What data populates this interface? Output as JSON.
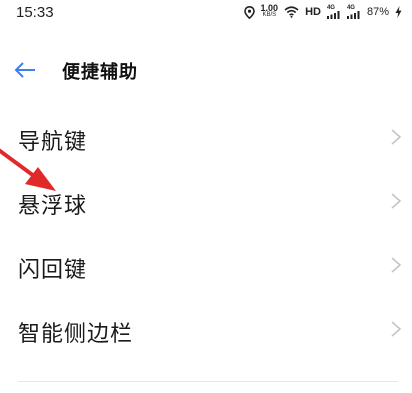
{
  "status_bar": {
    "time": "15:33",
    "net_speed_value": "1.00",
    "net_speed_unit": "KB/S",
    "hd_label": "HD",
    "sim1_label": "4G",
    "sim2_label": "4G",
    "battery": "87%",
    "icons": [
      "location-icon",
      "wifi-icon",
      "signal-icon",
      "charging-icon"
    ]
  },
  "header": {
    "back_icon": "arrow-left-icon",
    "title": "便捷辅助"
  },
  "list": {
    "items": [
      {
        "label": "导航键",
        "chevron": "chevron-right-icon"
      },
      {
        "label": "悬浮球",
        "chevron": "chevron-right-icon"
      },
      {
        "label": "闪回键",
        "chevron": "chevron-right-icon"
      },
      {
        "label": "智能侧边栏",
        "chevron": "chevron-right-icon"
      }
    ]
  },
  "colors": {
    "accent": "#3d7ff0",
    "annotation": "#e02a2a",
    "chevron": "#c4c4c4",
    "text": "#1a1a1a"
  }
}
